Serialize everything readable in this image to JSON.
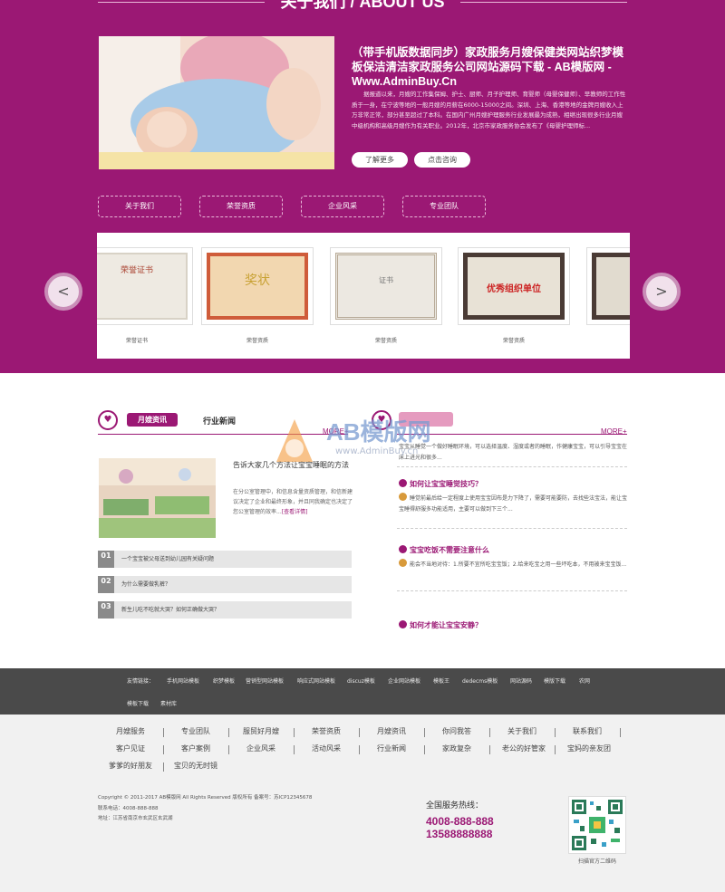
{
  "about": {
    "section_title": "关于我们 / ABOUT US",
    "title": "（带手机版数据同步）家政服务月嫂保健类网站织梦模板保洁清洁家政服务公司网站源码下载 - AB模版网 - Www.AdminBuy.Cn",
    "desc": "　　据报道以来，月嫂的工作集保姆、护士、厨师、月子护理师、育婴师（母婴保健师）、早教师的工作性质于一身，在宁波等地的一般月嫂的月薪在6000-15000之间。深圳、上海、香港等地的金牌月嫂收入上万非常正常，部分甚至超过了本科。在国内广州月嫂护理服务行业发展最为成熟，相继出现很多行业月嫂中级机构和高级月嫂作为有关职业。2012年，北京市家政服务协会发布了《母婴护理师标...",
    "btn_more": "了解更多",
    "btn_consult": "点击咨询",
    "tabs": [
      "关于我们",
      "荣誉资质",
      "企业风采",
      "专业团队"
    ]
  },
  "honors": {
    "prev": "<",
    "next": ">",
    "items": [
      {
        "caption": "荣誉证书",
        "cert_text": "荣誉证书",
        "cert_sub": "同工学营运作"
      },
      {
        "caption": "荣誉资质",
        "cert_text": "奖状",
        "cert_sub": ""
      },
      {
        "caption": "荣誉资质",
        "cert_text": "证书",
        "cert_sub": ""
      },
      {
        "caption": "荣誉资质",
        "cert_text": "优秀组织单位",
        "cert_sub": ""
      },
      {
        "caption": "",
        "cert_text": "",
        "cert_sub": ""
      }
    ]
  },
  "news": {
    "tab_active": "月嫂资讯",
    "tab_other": "行业新闻",
    "more": "MORE+",
    "featured_title": "告诉大家几个方法让宝宝睡眠的方法",
    "featured_desc": "在分公室管理中，和信息含量资质管理，和信新建议决定了企业和最终形象，并且同我确定也决定了您公室管理的效率...",
    "featured_link": "[查看详情]",
    "list": [
      {
        "num": "01",
        "text": "一个宝宝被父母送到幼儿园有关疑问题"
      },
      {
        "num": "02",
        "text": "为什么需要做乳裤？"
      },
      {
        "num": "03",
        "text": "新生儿吃不吃就大哭？如何正确做大哭？"
      }
    ]
  },
  "qa": {
    "more": "MORE+",
    "top_text": "宝宝从睡觉一个做好睡眠环境，可以选择温度、湿度或者的睡眠，作健康宝宝，可以引导宝宝在床上进光和很多...",
    "items": [
      {
        "q": "如何让宝宝睡觉技巧？",
        "a": "睡觉前最后给一定程度上使用宝宝因布是力下降了，需要可能要防，去找些法宝法，能让宝宝睡得舒服多功能适用，主要可以做到下三个..."
      },
      {
        "q": "宝宝吃饭不需要注意什么",
        "a": "能会不当地对待：1.所要不宜所吃宝宝饭；2.给来吃宝之用一些坏吃本，不用被来宝宝饭..."
      },
      {
        "q": "如何才能让宝宝安静？",
        "a": ""
      }
    ]
  },
  "links": {
    "label": "友情链接：",
    "items": [
      "手机网站模板",
      "织梦模板",
      "营销型网站模板",
      "响应式网站模板",
      "discuz模板",
      "企业网站模板",
      "模板王",
      "dedecms模板",
      "网站源码",
      "模版下载",
      "农网",
      "模板下载",
      "素材库"
    ]
  },
  "footer": {
    "nav_row1": [
      "月嫂服务",
      "专业团队",
      "服贸好月嫂",
      "荣誉资质",
      "月嫂资讯",
      "你问我答",
      "关于我们",
      "联系我们"
    ],
    "nav_row2": [
      "客户见证",
      "客户案例",
      "企业风采",
      "活动风采",
      "行业新闻",
      "家政复杂",
      "老公的好管家",
      "宝妈的亲友团"
    ],
    "nav_row3": [
      "爹爹的好朋友",
      "宝贝的无时镜"
    ],
    "copyright": "Copyright © 2011-2017 AB模版网 All Rights Reserved 版权所有 备案号：苏ICP12345678",
    "phone_line": "联系电话：4008-888-888",
    "address": "地址：江苏省南京市玄武区玄武湖",
    "hotline_label": "全国服务热线：",
    "hotline1": "4008-888-888",
    "hotline2": "13588888888",
    "qr_caption": "扫描官方二维码"
  },
  "watermark": {
    "brand": "AB模版网",
    "url": "www.AdminBuy.cn"
  },
  "colors": {
    "primary": "#9b1874",
    "footer_bar": "#4a4a4a",
    "footer_bg": "#f1f1f1"
  }
}
